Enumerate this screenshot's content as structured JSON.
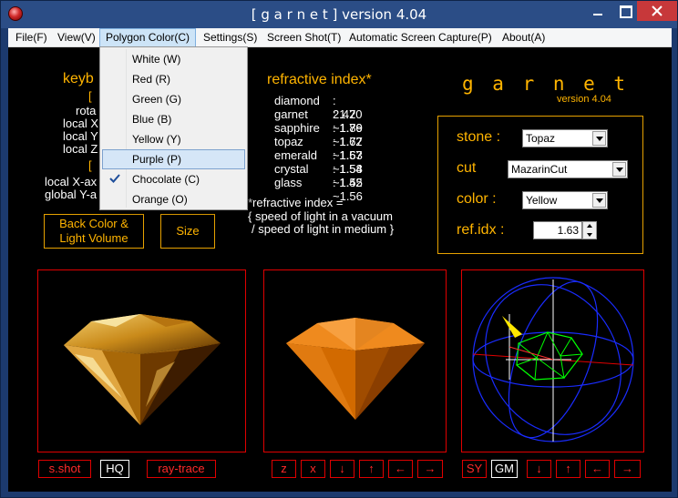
{
  "window": {
    "title": "[ g a r n e t ]  version 4.04"
  },
  "menubar": [
    {
      "label": "File(F)"
    },
    {
      "label": "View(V)"
    },
    {
      "label": "Polygon Color(C)"
    },
    {
      "label": "Settings(S)"
    },
    {
      "label": "Screen Shot(T)"
    },
    {
      "label": "Automatic Screen Capture(P)"
    },
    {
      "label": "About(A)"
    }
  ],
  "polygon_color_menu": {
    "items": [
      {
        "label": "White (W)"
      },
      {
        "label": "Red (R)"
      },
      {
        "label": "Green (G)"
      },
      {
        "label": "Blue (B)"
      },
      {
        "label": "Yellow (Y)"
      },
      {
        "label": "Purple (P)"
      },
      {
        "label": "Chocolate (C)"
      },
      {
        "label": "Orange (O)"
      }
    ],
    "hovered": "Purple (P)",
    "checked": "Chocolate (C)"
  },
  "keyboard": {
    "heading": "keyb",
    "bracket1": "[",
    "line1": "rota",
    "line2": "local X",
    "line3": "local Y",
    "line4": "local Z",
    "bracket2": "[",
    "line5": "local X-ax",
    "line6": "global Y-a"
  },
  "buttons": {
    "back_color": "Back Color &\nLight Volume",
    "size": "Size"
  },
  "refractive": {
    "title": "refractive index*",
    "rows": [
      {
        "name": "diamond",
        "value": ": 2.42"
      },
      {
        "name": "garnet",
        "value": ": 1.70 ~1.89"
      },
      {
        "name": "sapphire",
        "value": ": 1.76 ~1.77"
      },
      {
        "name": "topaz",
        "value": ": 1.62 ~1.63"
      },
      {
        "name": "emerald",
        "value": ": 1.57 ~1.58"
      },
      {
        "name": "crystal",
        "value": ": 1.54 ~1.55"
      },
      {
        "name": "glass",
        "value": ": 1.42 ~1.56"
      }
    ],
    "note1": "*refractive index =",
    "note2": "{ speed of light in a vacuum",
    "note3": "/ speed of light in medium }"
  },
  "brand": {
    "name": "g a r n e t",
    "version": "version 4.04"
  },
  "props": {
    "stone_label": "stone :",
    "stone_value": "Topaz",
    "cut_label": "cut",
    "cut_value": "MazarinCut",
    "color_label": "color :",
    "color_value": "Yellow",
    "ref_label": "ref.idx :",
    "ref_value": "1.63"
  },
  "bottom_buttons": {
    "sshot": "s.shot",
    "hq": "HQ",
    "raytrace": "ray-trace",
    "z": "z",
    "x": "x",
    "down1": "↓",
    "up1": "↑",
    "left1": "←",
    "right1": "→",
    "sy": "SY",
    "gm": "GM",
    "down2": "↓",
    "up2": "↑",
    "left2": "←",
    "right2": "→"
  },
  "colors": {
    "accent": "#ffb400",
    "panel_border": "#e00000",
    "menu_hover": "#d5e6f7"
  }
}
